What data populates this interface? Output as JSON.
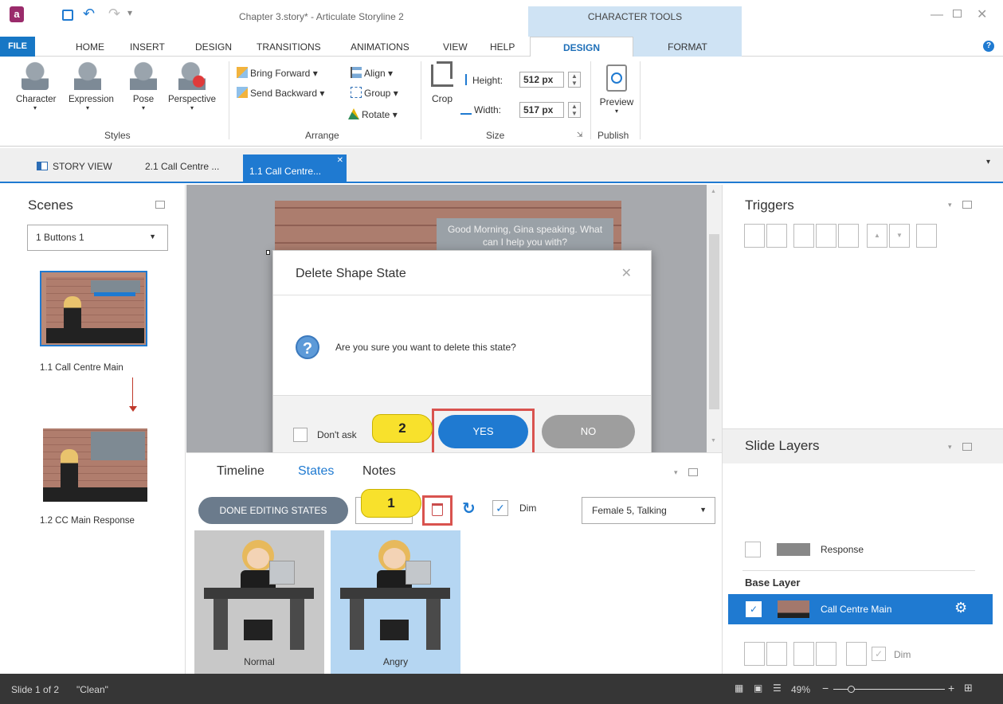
{
  "window": {
    "title": "Chapter 3.story* - Articulate Storyline 2",
    "contextual_group": "CHARACTER TOOLS"
  },
  "colors": {
    "accent": "#1f7ad1",
    "callout": "#f8e12c",
    "highlight": "#d9534f"
  },
  "menu": [
    "FILE",
    "HOME",
    "INSERT",
    "DESIGN",
    "TRANSITIONS",
    "ANIMATIONS",
    "VIEW",
    "HELP"
  ],
  "context_tabs": {
    "design": "DESIGN",
    "format": "FORMAT"
  },
  "ribbon": {
    "styles": {
      "character": "Character",
      "expression": "Expression",
      "pose": "Pose",
      "perspective": "Perspective",
      "label": "Styles"
    },
    "arrange": {
      "bring_forward": "Bring Forward",
      "send_backward": "Send Backward",
      "align": "Align",
      "group": "Group",
      "rotate": "Rotate",
      "label": "Arrange"
    },
    "size": {
      "crop": "Crop",
      "height_label": "Height:",
      "height_value": "512 px",
      "width_label": "Width:",
      "width_value": "517 px",
      "label": "Size"
    },
    "publish": {
      "preview": "Preview",
      "label": "Publish"
    }
  },
  "doc_tabs": {
    "story_view": "STORY VIEW",
    "tab1": "2.1 Call Centre ...",
    "tab2": "1.1 Call Centre..."
  },
  "scenes": {
    "title": "Scenes",
    "selected": "1 Buttons 1",
    "slides": [
      {
        "label": "1.1 Call Centre Main"
      },
      {
        "label": "1.2 CC Main Response"
      }
    ]
  },
  "stage": {
    "speech": "Good Morning, Gina speaking. What can I help you with?"
  },
  "dialog": {
    "title": "Delete Shape State",
    "message": "Are you sure you want to delete this state?",
    "dont_ask": "Don't ask",
    "yes": "YES",
    "no": "NO"
  },
  "callouts": {
    "one": "1",
    "two": "2"
  },
  "bottom": {
    "tabs": [
      "Timeline",
      "States",
      "Notes"
    ],
    "done": "DONE EDITING STATES",
    "dim": "Dim",
    "character": "Female 5, Talking",
    "states": [
      {
        "label": "Normal"
      },
      {
        "label": "Angry"
      }
    ]
  },
  "triggers": {
    "title": "Triggers"
  },
  "layers": {
    "title": "Slide Layers",
    "response": "Response",
    "base_layer": "Base Layer",
    "call_centre_main": "Call Centre Main",
    "dim": "Dim"
  },
  "status": {
    "slide": "Slide 1 of 2",
    "theme": "\"Clean\"",
    "zoom": "49%"
  }
}
